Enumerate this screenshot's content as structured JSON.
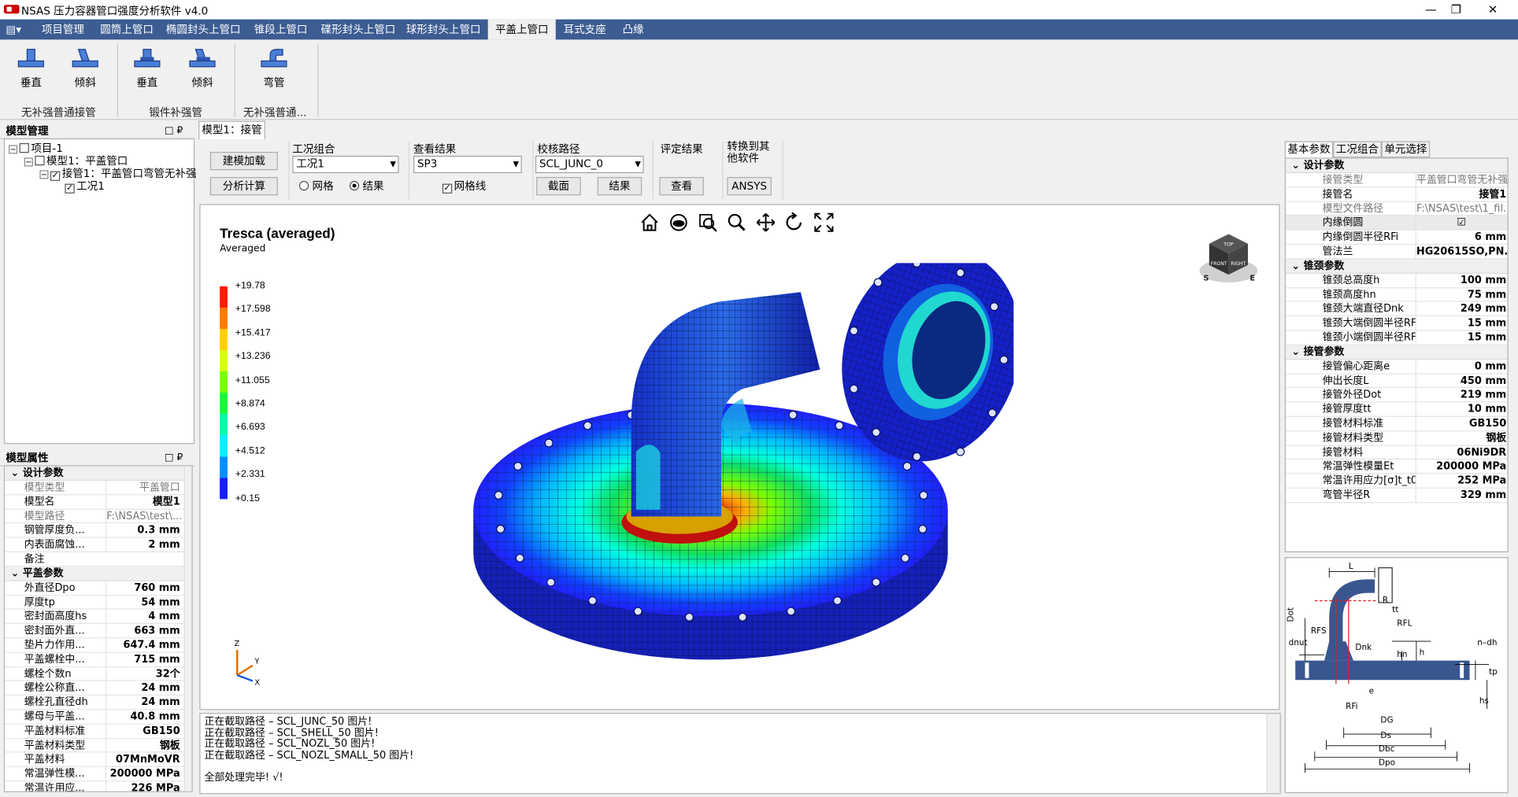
{
  "window": {
    "title": "NSAS 压力容器管口强度分析软件 v4.0",
    "min": "—",
    "max": "❐",
    "close": "✕"
  },
  "menu": [
    {
      "label": "▤▾",
      "active": false
    },
    {
      "label": "项目管理",
      "active": false
    },
    {
      "label": "圆筒上管口",
      "active": false
    },
    {
      "label": "椭圆封头上管口",
      "active": false
    },
    {
      "label": "锥段上管口",
      "active": false
    },
    {
      "label": "碟形封头上管口",
      "active": false
    },
    {
      "label": "球形封头上管口",
      "active": false
    },
    {
      "label": "平盖上管口",
      "active": true
    },
    {
      "label": "耳式支座",
      "active": false
    },
    {
      "label": "凸缘",
      "active": false
    }
  ],
  "ribbon": {
    "btns": [
      "垂直",
      "倾斜",
      "垂直",
      "倾斜",
      "弯管"
    ],
    "groups": [
      "无补强普通接管",
      "锻件补强管",
      "无补强普通..."
    ]
  },
  "model_tree": {
    "title": "模型管理",
    "pin": "□ ₽",
    "items": [
      "项目-1",
      "模型1：平盖管口",
      "接管1：平盖管口弯管无补强",
      "工况1"
    ]
  },
  "model_props": {
    "title": "模型属性",
    "pin": "□ ₽",
    "sections": [
      {
        "name": "设计参数",
        "rows": [
          [
            "模型类型",
            "平盖管口",
            true
          ],
          [
            "模型名",
            "模型1",
            false
          ],
          [
            "模型路径",
            "F:\\NSAS\\test\\...",
            true
          ],
          [
            "钢管厚度负...",
            "0.3 mm",
            false
          ],
          [
            "内表面腐蚀...",
            "2 mm",
            false
          ],
          [
            "备注",
            "",
            false
          ]
        ]
      },
      {
        "name": "平盖参数",
        "rows": [
          [
            "外直径Dpo",
            "760 mm",
            false
          ],
          [
            "厚度tp",
            "54 mm",
            false
          ],
          [
            "密封面高度hs",
            "4 mm",
            false
          ],
          [
            "密封面外直...",
            "663 mm",
            false
          ],
          [
            "垫片力作用...",
            "647.4 mm",
            false
          ],
          [
            "平盖螺栓中...",
            "715 mm",
            false
          ],
          [
            "螺栓个数n",
            "32个",
            false
          ],
          [
            "螺栓公称直...",
            "24 mm",
            false
          ],
          [
            "螺栓孔直径dh",
            "24 mm",
            false
          ],
          [
            "螺母与平盖...",
            "40.8 mm",
            false
          ],
          [
            "平盖材料标准",
            "GB150",
            false
          ],
          [
            "平盖材料类型",
            "钢板",
            false
          ],
          [
            "平盖材料",
            "07MnMoVR",
            false
          ],
          [
            "常温弹性模...",
            "200000 MPa",
            false
          ],
          [
            "常温许用应...",
            "226 MPa",
            false
          ]
        ]
      }
    ]
  },
  "doc_tab": "模型1：接管1",
  "tools": {
    "build": "建模加载",
    "analyze": "分析计算",
    "cond_label": "工况组合",
    "cond_value": "工况1",
    "mesh": "网格",
    "result": "结果",
    "view_label": "查看结果",
    "view_value": "SP3",
    "gridline": "网格线",
    "path_label": "校核路径",
    "path_value": "SCL_JUNC_0",
    "section_btn": "截面",
    "result_btn": "结果",
    "eval_label": "评定结果",
    "eval_btn": "查看",
    "convert_label": "转换到其他软件",
    "convert_btn": "ANSYS"
  },
  "plot": {
    "title": "Tresca (averaged)",
    "subtitle": "Averaged",
    "legend": [
      "+19.78",
      "+17.598",
      "+15.417",
      "+13.236",
      "+11.055",
      "+8.874",
      "+6.693",
      "+4.512",
      "+2.331",
      "+0.15"
    ],
    "legend_colors": [
      "#ff1a00",
      "#ff7a00",
      "#ffd000",
      "#d8ff00",
      "#7aff00",
      "#14ff3a",
      "#00ffa8",
      "#00f0ff",
      "#0090ff",
      "#1a1aff"
    ],
    "triad": {
      "z": "Z",
      "y": "Y",
      "x": "X"
    },
    "cube": {
      "top": "TOP",
      "front": "FRONT",
      "right": "RIGHT",
      "s": "S",
      "e": "E"
    }
  },
  "log": [
    "正在截取路径 – SCL_JUNC_50 图片!",
    "正在截取路径 – SCL_SHELL_50 图片!",
    "正在截取路径 – SCL_NOZL_50 图片!",
    "正在截取路径 – SCL_NOZL_SMALL_50 图片!",
    "",
    "全部处理完毕! √!"
  ],
  "right_tabs": [
    "基本参数",
    "工况组合",
    "单元选择"
  ],
  "right_props": {
    "sections": [
      {
        "name": "设计参数",
        "rows": [
          [
            "接管类型",
            "平盖管口弯管无补强",
            true,
            false
          ],
          [
            "接管名",
            "接管1",
            false,
            false
          ],
          [
            "模型文件路径",
            "F:\\NSAS\\test\\1_fil...",
            true,
            false
          ],
          [
            "内缘倒圆",
            "☑",
            false,
            true
          ],
          [
            "内缘倒圆半径RFi",
            "6 mm",
            false,
            false
          ],
          [
            "管法兰",
            "HG20615SO,PN...",
            false,
            false
          ]
        ]
      },
      {
        "name": "锥颈参数",
        "rows": [
          [
            "锥颈总高度h",
            "100 mm",
            false,
            false
          ],
          [
            "锥颈高度hn",
            "75 mm",
            false,
            false
          ],
          [
            "锥颈大端直径Dnk",
            "249 mm",
            false,
            false
          ],
          [
            "锥颈大端倒圆半径RFL",
            "15 mm",
            false,
            false
          ],
          [
            "锥颈小端倒圆半径RFs",
            "15 mm",
            false,
            false
          ]
        ]
      },
      {
        "name": "接管参数",
        "rows": [
          [
            "接管偏心距离e",
            "0 mm",
            false,
            false
          ],
          [
            "伸出长度L",
            "450 mm",
            false,
            false
          ],
          [
            "接管外径Dot",
            "219 mm",
            false,
            false
          ],
          [
            "接管厚度tt",
            "10 mm",
            false,
            false
          ],
          [
            "接管材料标准",
            "GB150",
            false,
            false
          ],
          [
            "接管材料类型",
            "钢板",
            false,
            false
          ],
          [
            "接管材料",
            "06Ni9DR",
            false,
            false
          ],
          [
            "常温弹性模量Et",
            "200000 MPa",
            false,
            false
          ],
          [
            "常温许用应力[σ]t_t0",
            "252 MPa",
            false,
            false
          ],
          [
            "弯管半径R",
            "329 mm",
            false,
            false
          ]
        ]
      }
    ]
  },
  "diagram_labels": {
    "L": "L",
    "Dot": "Dot",
    "R": "R",
    "tt": "tt",
    "RFL": "RFL",
    "RFS": "RFS",
    "dnut": "dnut",
    "Dnk": "Dnk",
    "hn": "hn",
    "h": "h",
    "ndh": "n–dh",
    "tp": "tp",
    "hs": "hs",
    "e": "e",
    "RFi": "RFi",
    "DG": "DG",
    "Ds": "Ds",
    "Dbc": "Dbc",
    "Dpo": "Dpo"
  }
}
